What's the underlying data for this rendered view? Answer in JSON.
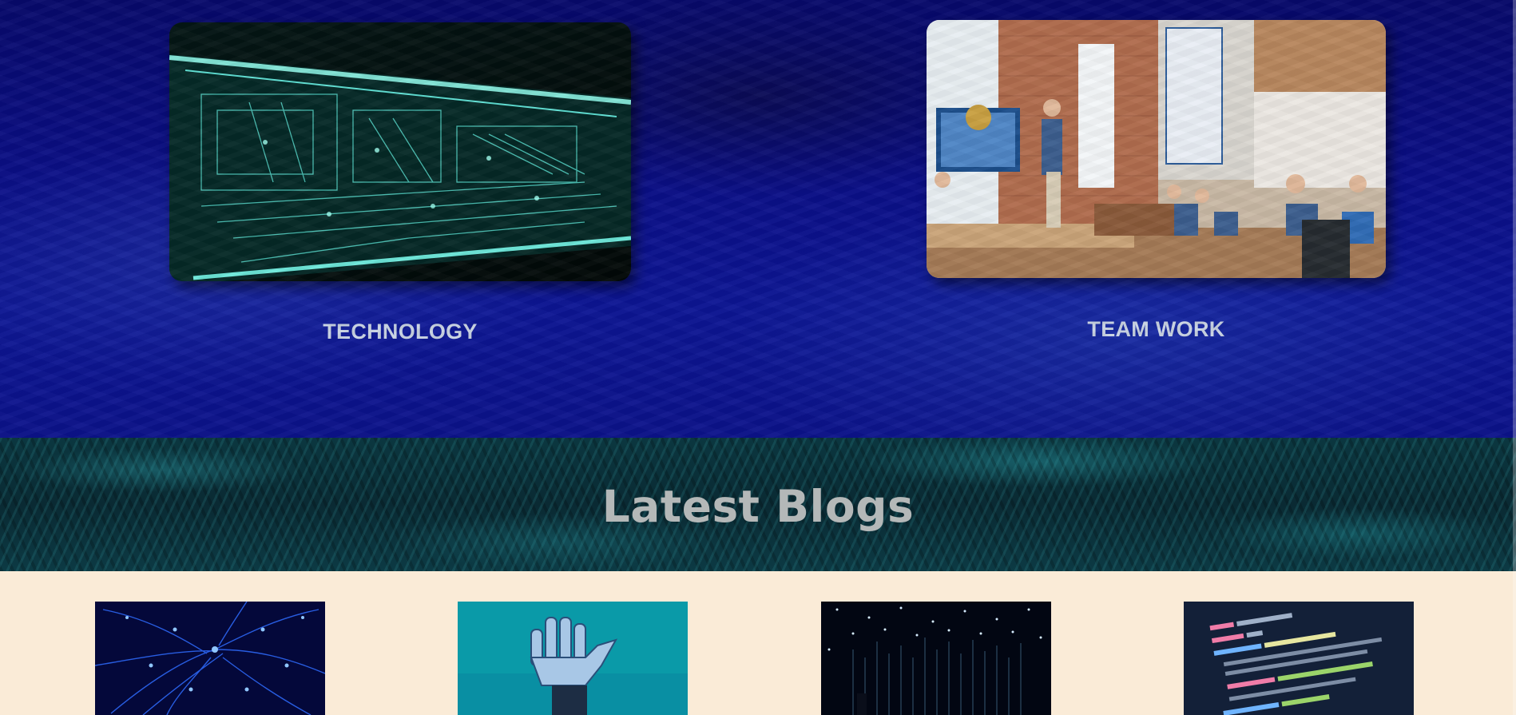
{
  "feature_cards": [
    {
      "title": "TECHNOLOGY",
      "image_icon": "circuit-board-image"
    },
    {
      "title": "TEAM WORK",
      "image_icon": "office-presentation-image"
    }
  ],
  "latest_blogs": {
    "heading": "Latest Blogs",
    "posts": [
      {
        "image_icon": "fiber-optic-image"
      },
      {
        "image_icon": "robot-hand-image"
      },
      {
        "image_icon": "light-particles-image"
      },
      {
        "image_icon": "code-screen-image"
      }
    ]
  },
  "colors": {
    "hero_bg": "#0a0e86",
    "banner_bg": "#0a2a33",
    "blogs_bg": "#faebd7",
    "card_title": "#c9d3e3",
    "banner_title": "#b4b8b8"
  }
}
